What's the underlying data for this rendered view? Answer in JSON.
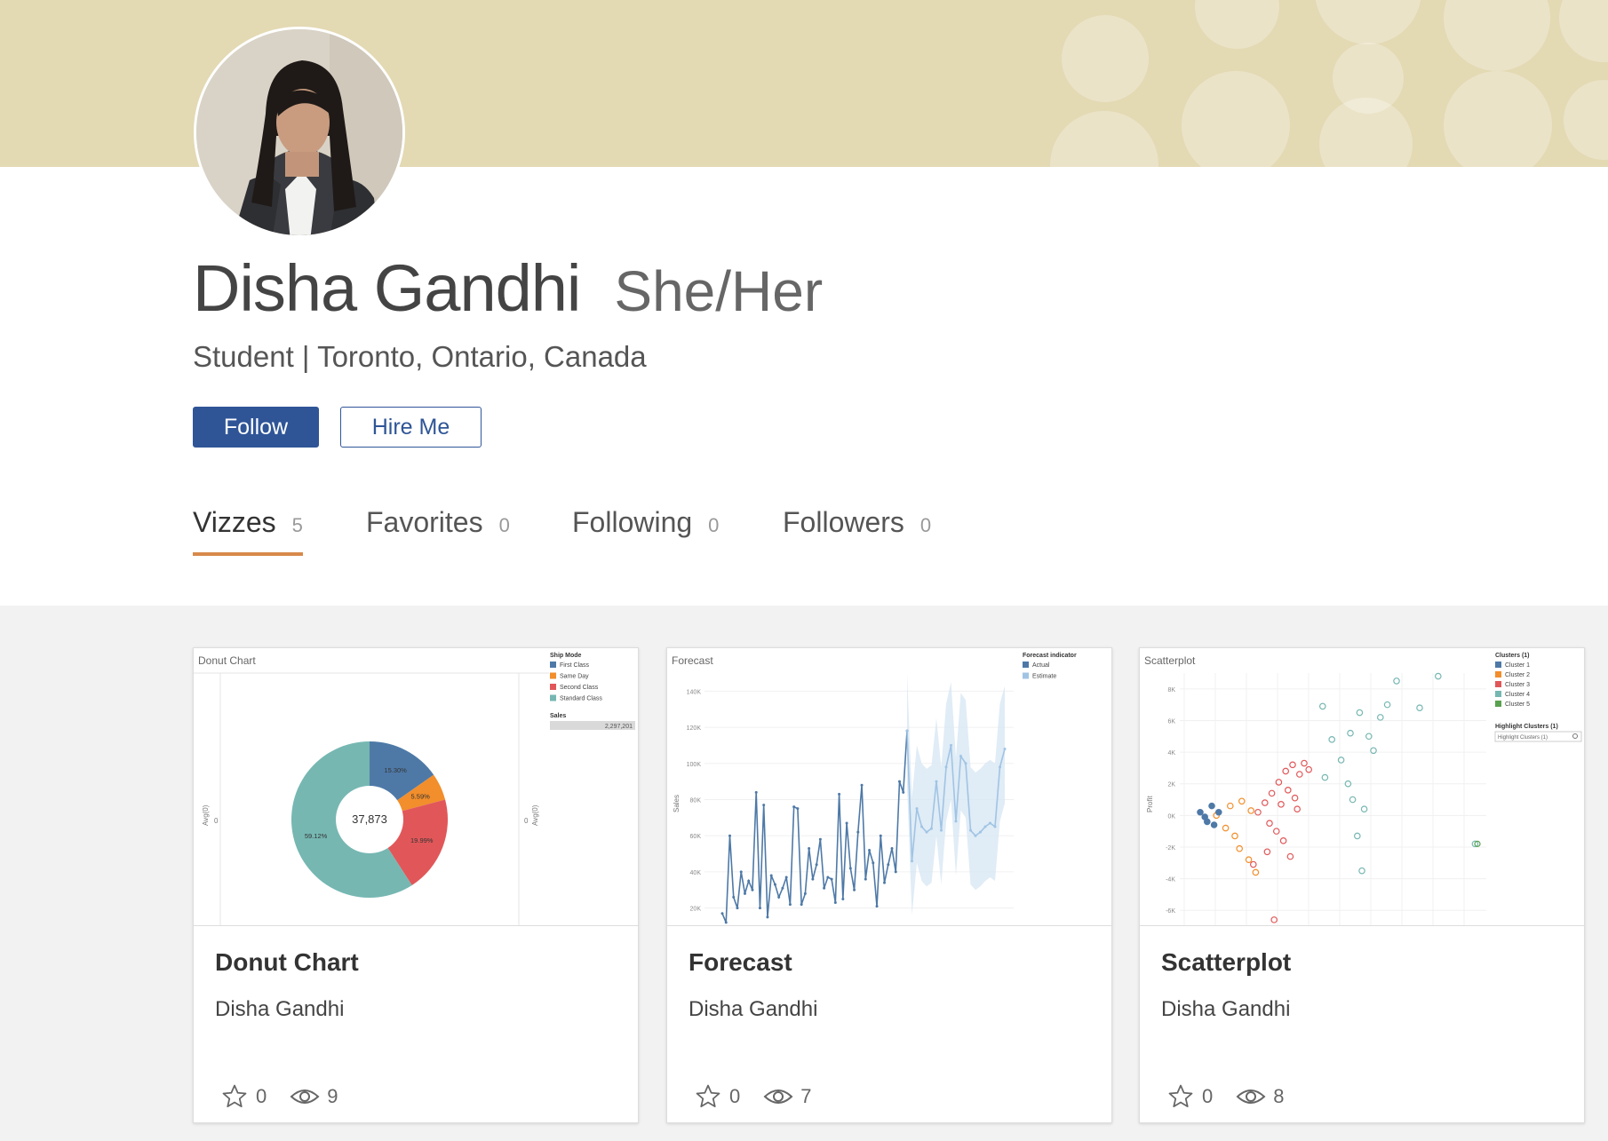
{
  "profile": {
    "name": "Disha Gandhi",
    "pronouns": "She/Her",
    "subtitle": "Student | Toronto, Ontario, Canada",
    "follow_label": "Follow",
    "hire_label": "Hire Me"
  },
  "tabs": [
    {
      "label": "Vizzes",
      "count": "5",
      "active": true
    },
    {
      "label": "Favorites",
      "count": "0"
    },
    {
      "label": "Following",
      "count": "0"
    },
    {
      "label": "Followers",
      "count": "0"
    }
  ],
  "cards": [
    {
      "title": "Donut Chart",
      "author": "Disha Gandhi",
      "favorites": "0",
      "views": "9"
    },
    {
      "title": "Forecast",
      "author": "Disha Gandhi",
      "favorites": "0",
      "views": "7"
    },
    {
      "title": "Scatterplot",
      "author": "Disha Gandhi",
      "favorites": "0",
      "views": "8"
    }
  ],
  "colors": {
    "banner": "#e3d9b3",
    "primary": "#2f5597",
    "tab_underline": "#d8894a",
    "blue": "#4e79a7",
    "orange": "#f28e2b",
    "red": "#e15759",
    "teal": "#76b7b2",
    "green": "#59a14f"
  },
  "icons": {
    "favorites": "star-icon",
    "views": "eye-icon"
  },
  "chart_data": [
    {
      "type": "pie",
      "title": "Donut Chart",
      "center_label": "37,873",
      "legend_title": "Ship Mode",
      "categories": [
        "First Class",
        "Same Day",
        "Second Class",
        "Standard Class"
      ],
      "values": [
        15.3,
        5.59,
        19.99,
        59.12
      ],
      "value_labels": [
        "15.30%",
        "5.59%",
        "19.99%",
        "59.12%"
      ],
      "sales_label": "Sales",
      "sales_value": "2,297,201",
      "left_axis_label": "Avg(0)",
      "right_axis_label": "Avg(0)",
      "axis_tick": "0"
    },
    {
      "type": "line",
      "title": "Forecast",
      "ylabel": "Sales",
      "legend_title": "Forecast indicator",
      "legend": [
        "Actual",
        "Estimate"
      ],
      "yticks": [
        "140K",
        "120K",
        "100K",
        "80K",
        "60K",
        "40K",
        "20K"
      ],
      "ylim": [
        10000,
        150000
      ],
      "series": [
        {
          "name": "Actual",
          "values": [
            17000,
            12000,
            60000,
            26000,
            20000,
            40000,
            28000,
            35000,
            30000,
            84000,
            20000,
            77000,
            15000,
            38000,
            33000,
            26000,
            31000,
            37000,
            22000,
            76000,
            75000,
            22000,
            28000,
            53000,
            36000,
            44000,
            58000,
            31000,
            37000,
            36000,
            23000,
            83000,
            25000,
            67000,
            42000,
            30000,
            62000,
            88000,
            36000,
            52000,
            45000,
            21000,
            60000,
            34000,
            44000,
            53000,
            40000,
            90000,
            84000,
            118000
          ]
        },
        {
          "name": "Estimate",
          "values": [
            118000,
            46000,
            75000,
            65000,
            62000,
            64000,
            90000,
            63000,
            98000,
            110000,
            68000,
            104000,
            100000,
            63000,
            60000,
            62000,
            65000,
            67000,
            65000,
            98000,
            108000
          ]
        }
      ]
    },
    {
      "type": "scatter",
      "title": "Scatterplot",
      "ylabel": "Profit",
      "legend_title": "Clusters (1)",
      "legend": [
        "Cluster 1",
        "Cluster 2",
        "Cluster 3",
        "Cluster 4",
        "Cluster 5"
      ],
      "highlight_label": "Highlight Clusters (1)",
      "highlight_placeholder": "Highlight Clusters (1)",
      "yticks": [
        "8K",
        "6K",
        "4K",
        "2K",
        "0K",
        "-2K",
        "-4K",
        "-6K"
      ],
      "ylim": [
        -7000,
        9000
      ],
      "series": [
        {
          "name": "Cluster 4",
          "points": [
            [
              0.59,
              2.4
            ],
            [
              0.62,
              4.8
            ],
            [
              0.58,
              6.9
            ],
            [
              0.66,
              3.5
            ],
            [
              0.7,
              5.2
            ],
            [
              0.74,
              6.5
            ],
            [
              0.69,
              2.0
            ],
            [
              0.71,
              1.0
            ],
            [
              0.76,
              0.4
            ],
            [
              0.73,
              -1.3
            ],
            [
              0.75,
              -3.5
            ],
            [
              0.78,
              5.0
            ],
            [
              0.8,
              4.1
            ],
            [
              0.83,
              6.2
            ],
            [
              0.86,
              7.0
            ],
            [
              0.9,
              8.5
            ],
            [
              1.0,
              6.8
            ],
            [
              1.08,
              8.8
            ],
            [
              1.24,
              -1.8
            ]
          ]
        },
        {
          "name": "Cluster 3",
          "points": [
            [
              0.3,
              0.2
            ],
            [
              0.33,
              0.8
            ],
            [
              0.36,
              1.4
            ],
            [
              0.39,
              2.1
            ],
            [
              0.42,
              2.8
            ],
            [
              0.45,
              3.2
            ],
            [
              0.48,
              2.6
            ],
            [
              0.5,
              3.3
            ],
            [
              0.35,
              -0.5
            ],
            [
              0.38,
              -1.0
            ],
            [
              0.41,
              -1.6
            ],
            [
              0.44,
              -2.6
            ],
            [
              0.34,
              -2.3
            ],
            [
              0.28,
              -3.1
            ],
            [
              0.47,
              0.4
            ],
            [
              0.52,
              2.9
            ],
            [
              0.4,
              0.7
            ],
            [
              0.43,
              1.6
            ],
            [
              0.46,
              1.1
            ],
            [
              0.37,
              -6.6
            ]
          ]
        },
        {
          "name": "Cluster 2",
          "points": [
            [
              0.12,
              0.0
            ],
            [
              0.16,
              -0.8
            ],
            [
              0.2,
              -1.3
            ],
            [
              0.22,
              -2.1
            ],
            [
              0.26,
              -2.8
            ],
            [
              0.29,
              -3.6
            ],
            [
              0.18,
              0.6
            ],
            [
              0.23,
              0.9
            ],
            [
              0.27,
              0.3
            ]
          ]
        },
        {
          "name": "Cluster 1",
          "points": [
            [
              0.05,
              0.2
            ],
            [
              0.08,
              -0.4
            ],
            [
              0.1,
              0.6
            ],
            [
              0.07,
              -0.1
            ],
            [
              0.11,
              -0.6
            ],
            [
              0.13,
              0.2
            ]
          ]
        }
      ]
    }
  ]
}
